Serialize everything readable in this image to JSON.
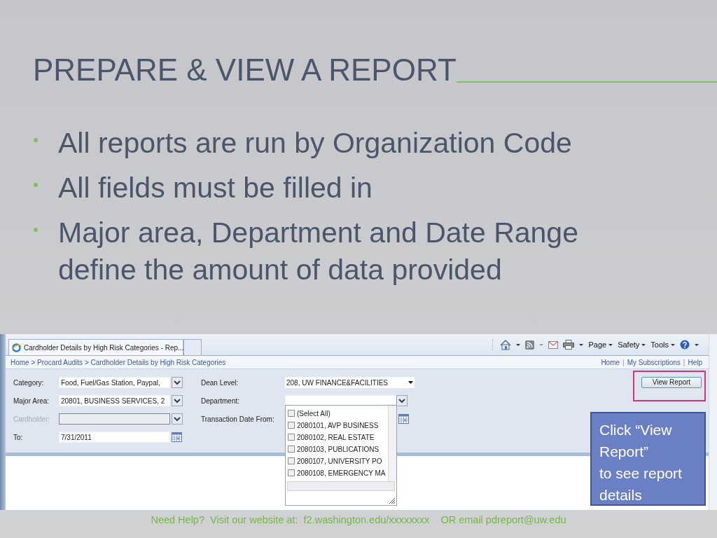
{
  "slide": {
    "title": "PREPARE & VIEW A REPORT",
    "bullets": [
      "All reports are run by Organization Code",
      "All fields must be filled in",
      "Major area, Department and Date Range define the amount of data provided"
    ]
  },
  "browser": {
    "tabs": [
      {
        "label": "Cardholder Details by High Risk Categories - Rep...",
        "selected": true
      }
    ],
    "toolbar": [
      {
        "kind": "home"
      },
      {
        "kind": "feed"
      },
      {
        "kind": "mail"
      },
      {
        "kind": "print"
      },
      {
        "kind": "menu",
        "label": "Page"
      },
      {
        "kind": "menu",
        "label": "Safety"
      },
      {
        "kind": "menu",
        "label": "Tools"
      },
      {
        "kind": "help"
      }
    ]
  },
  "report": {
    "breadcrumb": "Home > Procard Audits > Cardholder Details by High Risk Categories",
    "links": [
      "Home",
      "My Subscriptions",
      "Help"
    ],
    "link_separator": "|",
    "left_fields": [
      {
        "label": "Category:",
        "value": "Food, Fuel/Gas Station, Paypal,",
        "kind": "combo",
        "disabled": false
      },
      {
        "label": "Major Area:",
        "value": "20801, BUSINESS SERVICES, 2",
        "kind": "combo",
        "disabled": false
      },
      {
        "label": "Cardholder:",
        "kind": "combo",
        "disabled": true
      },
      {
        "label": "To:",
        "value": "7/31/2011",
        "kind": "date",
        "disabled": false
      }
    ],
    "right_fields": [
      {
        "label": "Dean Level:",
        "value": "208, UW FINANCE&FACILITIES",
        "kind": "select"
      },
      {
        "label": "Department:",
        "kind": "combo"
      },
      {
        "label": "Transaction Date From:",
        "kind": "date"
      }
    ],
    "department_options": [
      {
        "label": "(Select All)",
        "checked": false
      },
      {
        "label": "2080101, AVP BUSINESS",
        "checked": false
      },
      {
        "label": "2080102, REAL ESTATE",
        "checked": false
      },
      {
        "label": "2080103, PUBLICATIONS",
        "checked": false
      },
      {
        "label": "2080107, UNIVERSITY PO",
        "checked": false
      },
      {
        "label": "2080108, EMERGENCY MA",
        "checked": false
      }
    ],
    "view_button": "View Report"
  },
  "callout": {
    "lines": [
      "Click “View Report”",
      "to see report details"
    ]
  },
  "footer": "Need Help?  Visit our website at:  f2.washington.edu/xxxxxxxx    OR email pdreport@uw.edu"
}
